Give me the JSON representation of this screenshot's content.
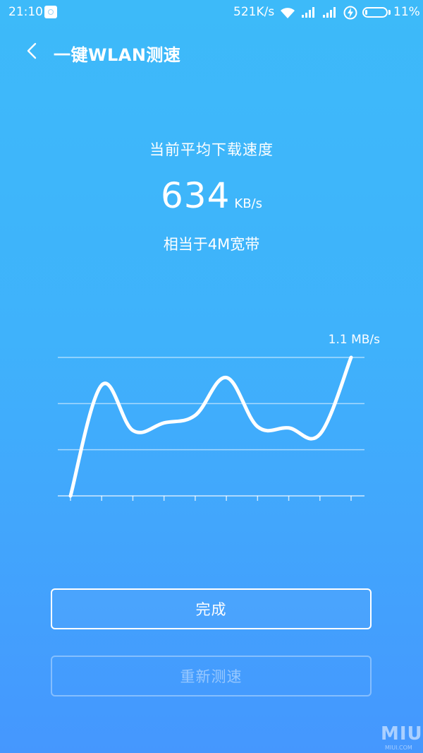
{
  "status_bar": {
    "time": "21:10",
    "network_speed": "521K/s",
    "battery_percent": "11%",
    "battery_level": 0.11,
    "icons": [
      "notification-icon",
      "wifi-icon",
      "signal-icon",
      "signal-icon",
      "charging-icon",
      "battery-icon"
    ]
  },
  "header": {
    "back_icon": "chevron-left-icon",
    "title": "一键WLAN测速"
  },
  "result": {
    "caption": "当前平均下载速度",
    "speed_value": "634",
    "speed_unit": "KB/s",
    "bandwidth": "相当于4M宽带"
  },
  "chart_data": {
    "type": "line",
    "max_label": "1.1 MB/s",
    "ylim": [
      0,
      1.1
    ],
    "grid": true,
    "x_ticks": 10,
    "x": [
      0,
      1,
      2,
      3,
      4,
      5,
      6,
      7,
      8,
      9
    ],
    "series": [
      {
        "values": [
          0,
          0.88,
          0.52,
          0.58,
          0.64,
          0.94,
          0.55,
          0.54,
          0.49,
          1.1
        ]
      }
    ]
  },
  "buttons": {
    "done_label": "完成",
    "retest_label": "重新测速"
  },
  "watermark": {
    "brand": "MIUI",
    "sub": "MIUI.COM"
  },
  "colors": {
    "bg_top": "#3dbaf9",
    "bg_bottom": "#4597fe",
    "foreground": "#ffffff"
  }
}
